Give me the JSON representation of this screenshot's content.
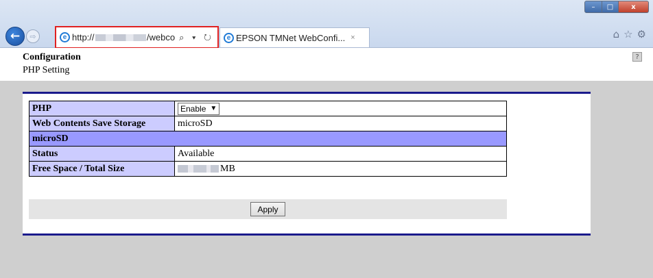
{
  "browser": {
    "url_prefix": "http://",
    "url_suffix": "/webco",
    "tab_title": "EPSON TMNet WebConfi...",
    "tab_close": "×",
    "win_minimize": "–",
    "win_maximize": "□",
    "win_close": "x",
    "back_glyph": "←",
    "fwd_glyph": "⇨",
    "addr_tools": "⌕ ▾ ↻",
    "home_icon": "⌂",
    "star_icon": "☆",
    "gear_icon": "⚙"
  },
  "header": {
    "title": "Configuration",
    "subtitle": "PHP Setting",
    "help": "?"
  },
  "settings": {
    "php_label": "PHP",
    "php_value": "Enable",
    "storage_label": "Web Contents Save Storage",
    "storage_value": "microSD",
    "section_label": "microSD",
    "status_label": "Status",
    "status_value": "Available",
    "space_label": "Free Space / Total Size",
    "space_unit": "MB"
  },
  "actions": {
    "apply_label": "Apply"
  }
}
